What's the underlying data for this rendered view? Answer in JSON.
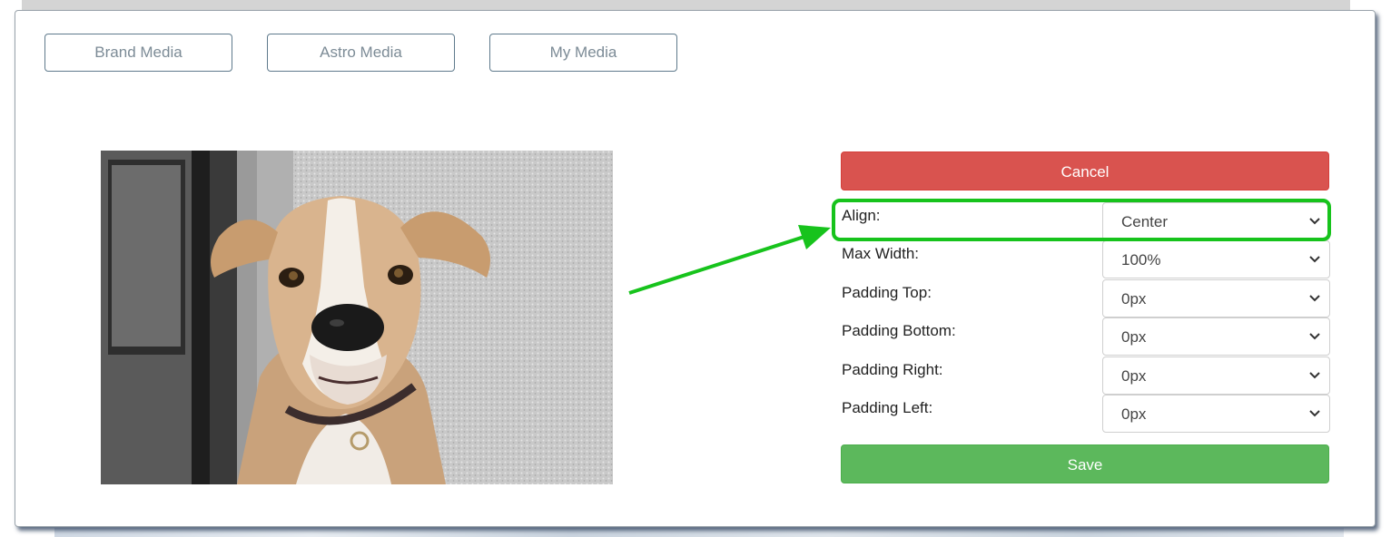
{
  "tabs": [
    {
      "label": "Brand Media"
    },
    {
      "label": "Astro Media"
    },
    {
      "label": "My Media"
    }
  ],
  "preview": {
    "alt": "Boxer dog photo"
  },
  "cancel_label": "Cancel",
  "save_label": "Save",
  "settings": [
    {
      "label": "Align:",
      "value": "Center"
    },
    {
      "label": "Max Width:",
      "value": "100%"
    },
    {
      "label": "Padding Top:",
      "value": "0px"
    },
    {
      "label": "Padding Bottom:",
      "value": "0px"
    },
    {
      "label": "Padding Right:",
      "value": "0px"
    },
    {
      "label": "Padding Left:",
      "value": "0px"
    }
  ],
  "colors": {
    "cancel": "#d9534f",
    "save": "#5cb85c",
    "highlight": "#17c31c"
  },
  "icons": {
    "select_chevron": "chevron-down-icon",
    "annotation": "arrow-icon"
  }
}
